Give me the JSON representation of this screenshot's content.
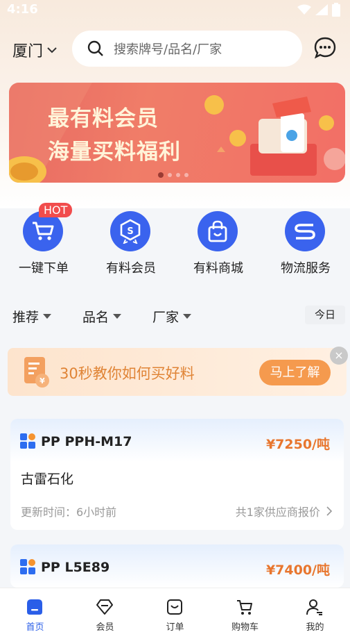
{
  "status_bar": {
    "time": "4:16"
  },
  "header": {
    "city": "厦门",
    "search_placeholder": "搜索牌号/品名/厂家"
  },
  "banner": {
    "line1": "最有料会员",
    "line2": "海量买料福利"
  },
  "quick_actions": [
    {
      "label": "一键下单",
      "icon": "cart-icon",
      "badge": "HOT"
    },
    {
      "label": "有料会员",
      "icon": "member-badge-icon"
    },
    {
      "label": "有料商城",
      "icon": "shopping-bag-icon"
    },
    {
      "label": "物流服务",
      "icon": "logistics-icon"
    }
  ],
  "filters": {
    "recommend": "推荐",
    "product_name": "品名",
    "manufacturer": "厂家",
    "today": "今日"
  },
  "tip": {
    "text": "30秒教你如何买好料",
    "button": "马上了解",
    "close": "×"
  },
  "products": [
    {
      "name": "PP PPH-M17",
      "price": "¥7250/吨",
      "maker": "古雷石化",
      "updated": "更新时间：6小时前",
      "suppliers": "共1家供应商报价"
    },
    {
      "name": "PP L5E89",
      "price": "¥7400/吨"
    }
  ],
  "tabbar": [
    {
      "label": "首页",
      "icon": "home-icon",
      "active": true
    },
    {
      "label": "会员",
      "icon": "diamond-icon"
    },
    {
      "label": "订单",
      "icon": "order-icon"
    },
    {
      "label": "购物车",
      "icon": "cart-icon"
    },
    {
      "label": "我的",
      "icon": "user-icon"
    }
  ],
  "colors": {
    "accent": "#3a63ee",
    "price": "#e8762e",
    "hot": "#f14c4c",
    "tip_button": "#f59a4e"
  }
}
